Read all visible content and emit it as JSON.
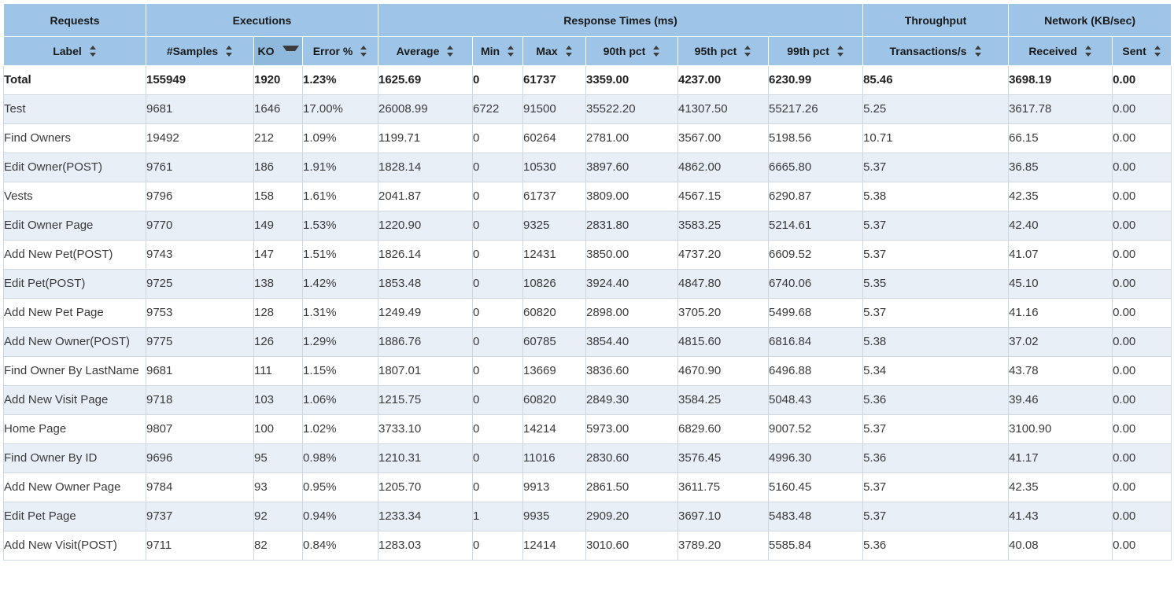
{
  "table": {
    "group_headers": [
      {
        "label": "Requests",
        "span": 1
      },
      {
        "label": "Executions",
        "span": 3
      },
      {
        "label": "Response Times (ms)",
        "span": 6
      },
      {
        "label": "Throughput",
        "span": 1
      },
      {
        "label": "Network (KB/sec)",
        "span": 2
      }
    ],
    "columns": [
      {
        "label": "Label",
        "sort": "both"
      },
      {
        "label": "#Samples",
        "sort": "both"
      },
      {
        "label": "KO",
        "sort": "desc"
      },
      {
        "label": "Error %",
        "sort": "both"
      },
      {
        "label": "Average",
        "sort": "both"
      },
      {
        "label": "Min",
        "sort": "both"
      },
      {
        "label": "Max",
        "sort": "both"
      },
      {
        "label": "90th pct",
        "sort": "both"
      },
      {
        "label": "95th pct",
        "sort": "both"
      },
      {
        "label": "99th pct",
        "sort": "both"
      },
      {
        "label": "Transactions/s",
        "sort": "both"
      },
      {
        "label": "Received",
        "sort": "both"
      },
      {
        "label": "Sent",
        "sort": "both"
      }
    ],
    "sorted_column": "KO",
    "sort_direction": "desc",
    "rows": [
      {
        "total": true,
        "cells": [
          "Total",
          "155949",
          "1920",
          "1.23%",
          "1625.69",
          "0",
          "61737",
          "3359.00",
          "4237.00",
          "6230.99",
          "85.46",
          "3698.19",
          "0.00"
        ]
      },
      {
        "total": false,
        "cells": [
          "Test",
          "9681",
          "1646",
          "17.00%",
          "26008.99",
          "6722",
          "91500",
          "35522.20",
          "41307.50",
          "55217.26",
          "5.25",
          "3617.78",
          "0.00"
        ]
      },
      {
        "total": false,
        "cells": [
          "Find Owners",
          "19492",
          "212",
          "1.09%",
          "1199.71",
          "0",
          "60264",
          "2781.00",
          "3567.00",
          "5198.56",
          "10.71",
          "66.15",
          "0.00"
        ]
      },
      {
        "total": false,
        "cells": [
          "Edit Owner(POST)",
          "9761",
          "186",
          "1.91%",
          "1828.14",
          "0",
          "10530",
          "3897.60",
          "4862.00",
          "6665.80",
          "5.37",
          "36.85",
          "0.00"
        ]
      },
      {
        "total": false,
        "cells": [
          "Vests",
          "9796",
          "158",
          "1.61%",
          "2041.87",
          "0",
          "61737",
          "3809.00",
          "4567.15",
          "6290.87",
          "5.38",
          "42.35",
          "0.00"
        ]
      },
      {
        "total": false,
        "cells": [
          "Edit Owner Page",
          "9770",
          "149",
          "1.53%",
          "1220.90",
          "0",
          "9325",
          "2831.80",
          "3583.25",
          "5214.61",
          "5.37",
          "42.40",
          "0.00"
        ]
      },
      {
        "total": false,
        "cells": [
          "Add New Pet(POST)",
          "9743",
          "147",
          "1.51%",
          "1826.14",
          "0",
          "12431",
          "3850.00",
          "4737.20",
          "6609.52",
          "5.37",
          "41.07",
          "0.00"
        ]
      },
      {
        "total": false,
        "cells": [
          "Edit Pet(POST)",
          "9725",
          "138",
          "1.42%",
          "1853.48",
          "0",
          "10826",
          "3924.40",
          "4847.80",
          "6740.06",
          "5.35",
          "45.10",
          "0.00"
        ]
      },
      {
        "total": false,
        "cells": [
          "Add New Pet Page",
          "9753",
          "128",
          "1.31%",
          "1249.49",
          "0",
          "60820",
          "2898.00",
          "3705.20",
          "5499.68",
          "5.37",
          "41.16",
          "0.00"
        ]
      },
      {
        "total": false,
        "cells": [
          "Add New Owner(POST)",
          "9775",
          "126",
          "1.29%",
          "1886.76",
          "0",
          "60785",
          "3854.40",
          "4815.60",
          "6816.84",
          "5.38",
          "37.02",
          "0.00"
        ]
      },
      {
        "total": false,
        "cells": [
          "Find Owner By LastName",
          "9681",
          "111",
          "1.15%",
          "1807.01",
          "0",
          "13669",
          "3836.60",
          "4670.90",
          "6496.88",
          "5.34",
          "43.78",
          "0.00"
        ]
      },
      {
        "total": false,
        "cells": [
          "Add New Visit Page",
          "9718",
          "103",
          "1.06%",
          "1215.75",
          "0",
          "60820",
          "2849.30",
          "3584.25",
          "5048.43",
          "5.36",
          "39.46",
          "0.00"
        ]
      },
      {
        "total": false,
        "cells": [
          "Home Page",
          "9807",
          "100",
          "1.02%",
          "3733.10",
          "0",
          "14214",
          "5973.00",
          "6829.60",
          "9007.52",
          "5.37",
          "3100.90",
          "0.00"
        ]
      },
      {
        "total": false,
        "cells": [
          "Find Owner By ID",
          "9696",
          "95",
          "0.98%",
          "1210.31",
          "0",
          "11016",
          "2830.60",
          "3576.45",
          "4996.30",
          "5.36",
          "41.17",
          "0.00"
        ]
      },
      {
        "total": false,
        "cells": [
          "Add New Owner Page",
          "9784",
          "93",
          "0.95%",
          "1205.70",
          "0",
          "9913",
          "2861.50",
          "3611.75",
          "5160.45",
          "5.37",
          "42.35",
          "0.00"
        ]
      },
      {
        "total": false,
        "cells": [
          "Edit Pet Page",
          "9737",
          "92",
          "0.94%",
          "1233.34",
          "1",
          "9935",
          "2909.20",
          "3697.10",
          "5483.48",
          "5.37",
          "41.43",
          "0.00"
        ]
      },
      {
        "total": false,
        "cells": [
          "Add New Visit(POST)",
          "9711",
          "82",
          "0.84%",
          "1283.03",
          "0",
          "12414",
          "3010.60",
          "3789.20",
          "5585.84",
          "5.36",
          "40.08",
          "0.00"
        ]
      }
    ]
  },
  "colors": {
    "header_blue": "#9ec5e8",
    "header_blue_active": "#8fb8dd",
    "row_stripe": "#e8eff7",
    "border": "#d9e2ea",
    "text": "#3a3a3a"
  }
}
